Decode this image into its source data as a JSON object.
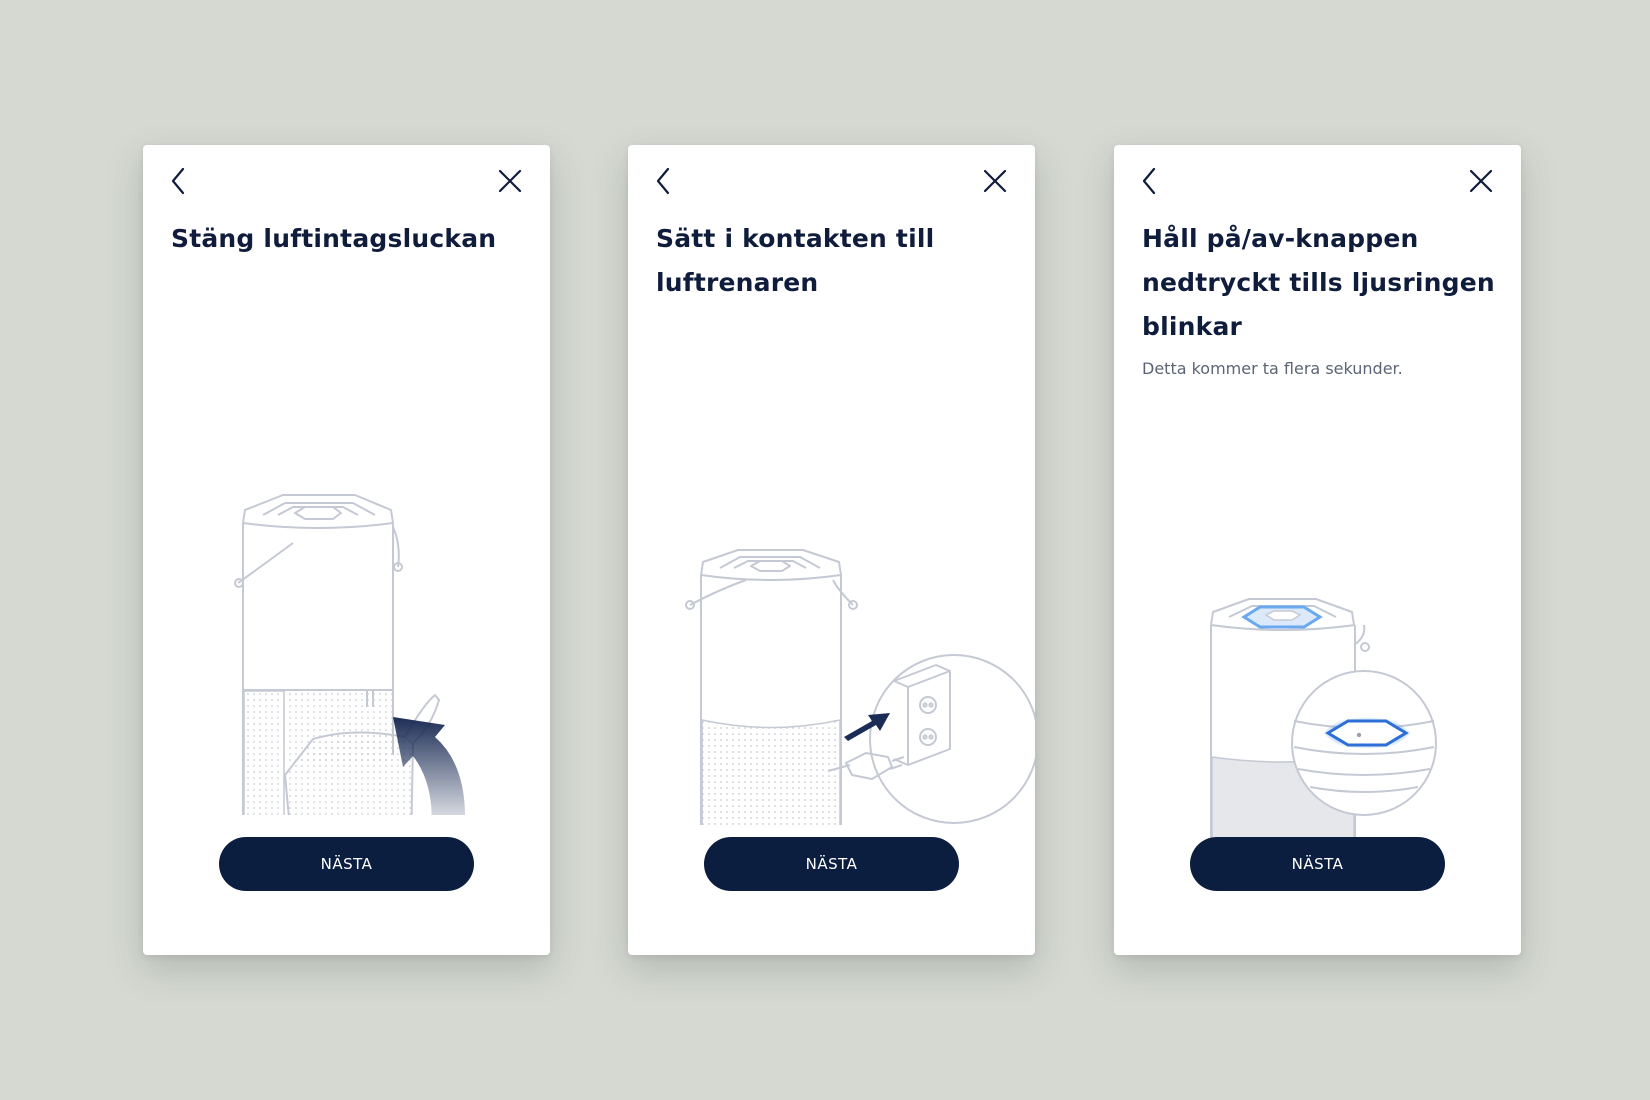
{
  "screens": [
    {
      "title": "Stäng luftintagsluckan",
      "next_label": "NÄSTA",
      "back_icon": "chevron-left-icon",
      "close_icon": "close-icon"
    },
    {
      "title": "Sätt i kontakten till luftrenaren",
      "next_label": "NÄSTA",
      "back_icon": "chevron-left-icon",
      "close_icon": "close-icon"
    },
    {
      "title": "Håll på/av-knappen nedtryckt tills ljusringen blinkar",
      "subtitle": "Detta kommer ta flera sekunder.",
      "next_label": "NÄSTA",
      "back_icon": "chevron-left-icon",
      "close_icon": "close-icon"
    }
  ],
  "colors": {
    "background": "#d5d9d2",
    "card": "#ffffff",
    "title_text": "#0f1c3b",
    "subtitle_text": "#5c6474",
    "button": "#0c1e40",
    "button_text": "#ffffff",
    "line_art": "#c5c9d3",
    "arrow": "#1c2d55",
    "light_ring": "#6aa8ef"
  }
}
